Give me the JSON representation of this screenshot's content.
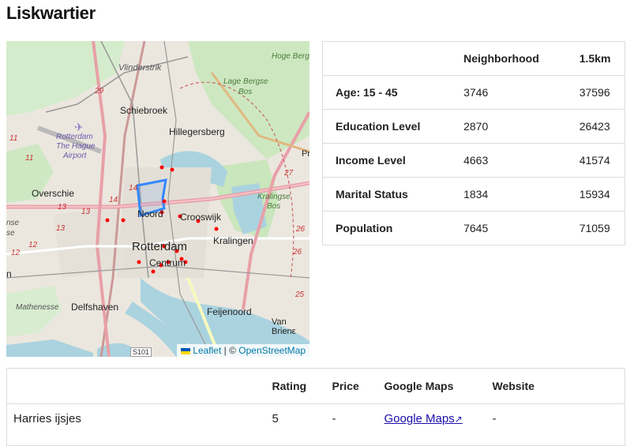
{
  "page": {
    "title": "Liskwartier"
  },
  "map": {
    "labels": {
      "vlinderstrik": "Vlinderstrik",
      "schiebroek": "Schiebroek",
      "hillegersberg": "Hillegersberg",
      "airport1": "Rotterdam",
      "airport2": "The Hague",
      "airport3": "Airport",
      "overschie": "Overschie",
      "noord": "Noord",
      "crooswijk": "Crooswijk",
      "kralingen": "Kralingen",
      "rotterdam": "Rotterdam",
      "centrum": "Centrum",
      "delfshaven": "Delfshaven",
      "mathenesse": "Mathenesse",
      "feijenoord": "Feijenoord",
      "vanbrienen": "Van Brienε",
      "hogebergse": "Hoge Berg",
      "lagebergse": "Lage Bergse",
      "bos1": "Bos",
      "kralingse": "Kralingse",
      "bos2": "Bos",
      "pr": "Pr",
      "nse": "nse",
      "se": "se",
      "n_left": "n",
      "s101": "S101",
      "road29": "29",
      "road11a": "11",
      "road11b": "11",
      "road13a": "13",
      "road13b": "13",
      "road13c": "13",
      "road14a": "14",
      "road14b": "14",
      "road12a": "12",
      "road12b": "12",
      "road27": "27",
      "road26a": "26",
      "road26b": "26",
      "road25": "25"
    },
    "attribution": {
      "leaflet": "Leaflet",
      "sep": " | © ",
      "osm": "OpenStreetMap"
    }
  },
  "stats": {
    "columns": [
      "",
      "Neighborhood",
      "1.5km"
    ],
    "rows": [
      {
        "label": "Age: 15 - 45",
        "neighborhood": "3746",
        "radius": "37596"
      },
      {
        "label": "Education Level",
        "neighborhood": "2870",
        "radius": "26423"
      },
      {
        "label": "Income Level",
        "neighborhood": "4663",
        "radius": "41574"
      },
      {
        "label": "Marital Status",
        "neighborhood": "1834",
        "radius": "15934"
      },
      {
        "label": "Population",
        "neighborhood": "7645",
        "radius": "71059"
      }
    ]
  },
  "places": {
    "columns": [
      "",
      "Rating",
      "Price",
      "Google Maps",
      "Website"
    ],
    "rows": [
      {
        "name": "Harries ijsjes",
        "rating": "5",
        "price": "-",
        "maps": "Google Maps",
        "website": "-"
      }
    ]
  },
  "colors": {
    "polygon": "#3388ff",
    "marker": "#ff0000",
    "link": "#1a0dab"
  }
}
